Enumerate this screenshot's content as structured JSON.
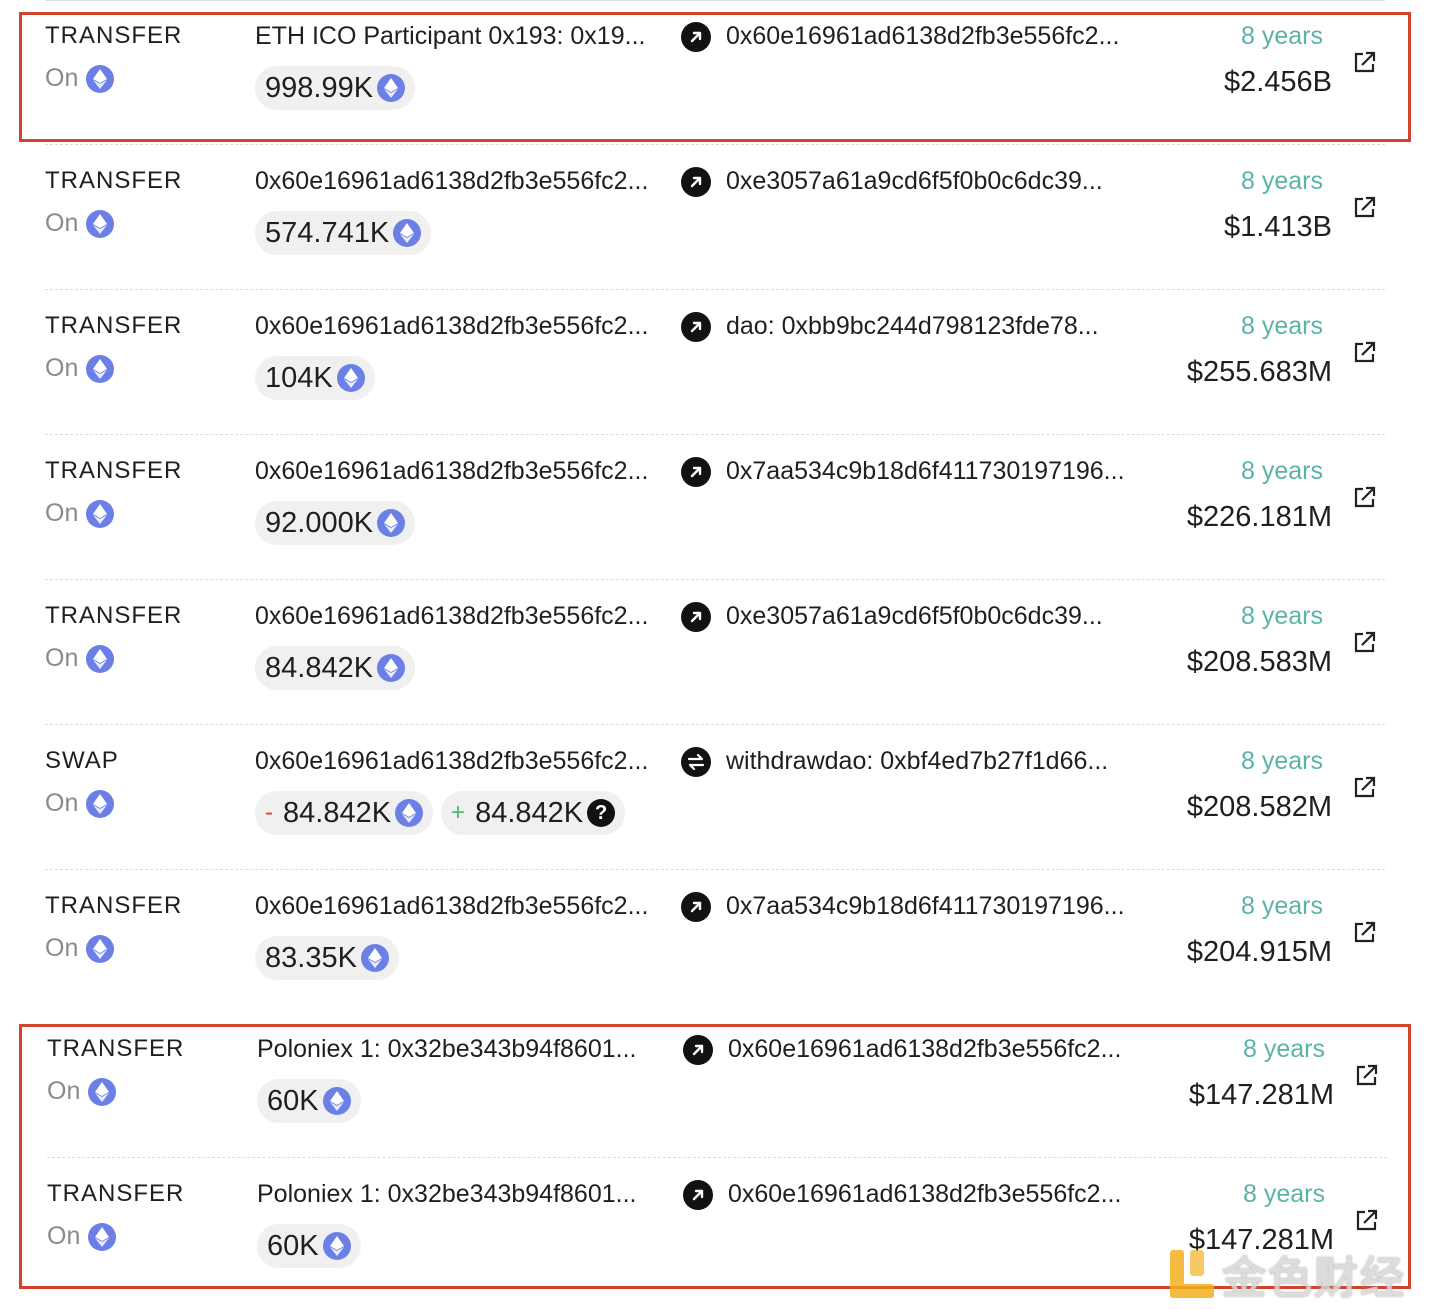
{
  "colors": {
    "highlight": "#d2432f",
    "age": "#5bb3a8",
    "eth": "#6c7fe6"
  },
  "transactions": [
    {
      "type": "TRANSFER",
      "chain": "On",
      "from": "ETH ICO Participant 0x193: 0x19...",
      "direction": "out-arrow-icon",
      "to": "0x60e16961ad6138d2fb3e556fc2...",
      "age": "8 years",
      "usd": "$2.456B",
      "amount": "998.99K",
      "token": "eth"
    },
    {
      "type": "TRANSFER",
      "chain": "On",
      "from": "0x60e16961ad6138d2fb3e556fc2...",
      "direction": "out-arrow-icon",
      "to": "0xe3057a61a9cd6f5f0b0c6dc39...",
      "age": "8 years",
      "usd": "$1.413B",
      "amount": "574.741K",
      "token": "eth"
    },
    {
      "type": "TRANSFER",
      "chain": "On",
      "from": "0x60e16961ad6138d2fb3e556fc2...",
      "direction": "out-arrow-icon",
      "to": "dao: 0xbb9bc244d798123fde78...",
      "age": "8 years",
      "usd": "$255.683M",
      "amount": "104K",
      "token": "eth"
    },
    {
      "type": "TRANSFER",
      "chain": "On",
      "from": "0x60e16961ad6138d2fb3e556fc2...",
      "direction": "out-arrow-icon",
      "to": "0x7aa534c9b18d6f411730197196...",
      "age": "8 years",
      "usd": "$226.181M",
      "amount": "92.000K",
      "token": "eth"
    },
    {
      "type": "TRANSFER",
      "chain": "On",
      "from": "0x60e16961ad6138d2fb3e556fc2...",
      "direction": "out-arrow-icon",
      "to": "0xe3057a61a9cd6f5f0b0c6dc39...",
      "age": "8 years",
      "usd": "$208.583M",
      "amount": "84.842K",
      "token": "eth"
    },
    {
      "type": "SWAP",
      "chain": "On",
      "from": "0x60e16961ad6138d2fb3e556fc2...",
      "direction": "swap-icon",
      "to": "withdrawdao: 0xbf4ed7b27f1d66...",
      "age": "8 years",
      "usd": "$208.582M",
      "swap_out": {
        "sign": "-",
        "amount": "84.842K",
        "token": "eth"
      },
      "swap_in": {
        "sign": "+",
        "amount": "84.842K",
        "token": "unknown"
      }
    },
    {
      "type": "TRANSFER",
      "chain": "On",
      "from": "0x60e16961ad6138d2fb3e556fc2...",
      "direction": "out-arrow-icon",
      "to": "0x7aa534c9b18d6f411730197196...",
      "age": "8 years",
      "usd": "$204.915M",
      "amount": "83.35K",
      "token": "eth"
    },
    {
      "type": "TRANSFER",
      "chain": "On",
      "from": "Poloniex 1: 0x32be343b94f8601...",
      "direction": "out-arrow-icon",
      "to": "0x60e16961ad6138d2fb3e556fc2...",
      "age": "8 years",
      "usd": "$147.281M",
      "amount": "60K",
      "token": "eth"
    },
    {
      "type": "TRANSFER",
      "chain": "On",
      "from": "Poloniex 1: 0x32be343b94f8601...",
      "direction": "out-arrow-icon",
      "to": "0x60e16961ad6138d2fb3e556fc2...",
      "age": "8 years",
      "usd": "$147.281M",
      "amount": "60K",
      "token": "eth"
    }
  ],
  "watermark": {
    "text": "金色财经"
  }
}
